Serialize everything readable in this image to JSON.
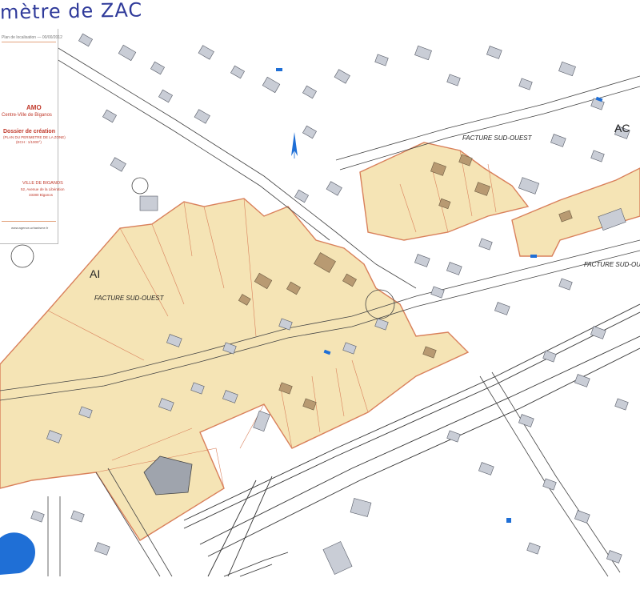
{
  "handwritten_title": "mètre de ZAC",
  "legend": {
    "header_line": "Plan de localisation — 00/00/2012",
    "amo": "AMO",
    "project": "Centre-Ville de Biganos",
    "dossier": "Dossier de création",
    "dossier_sub": "(PLAN DU PERIMETRE DE LA ZONE)",
    "scale": "(ECH : 1/1000°)",
    "client": "VILLE DE BIGANOS",
    "address": "52, Avenue de la Libération",
    "postcode": "33380 Biganos",
    "website": "www.agence-urbanisme.fr"
  },
  "labels": {
    "section_ai": "AI",
    "section_ac": "AC",
    "facture_west": "FACTURE SUD-OUEST",
    "facture_north": "FACTURE SUD-OUEST",
    "facture_east": "FACTURE SUD-OUEST"
  },
  "colors": {
    "zac_fill": "#f5e4b5",
    "zac_stroke": "#d9805b",
    "building": "#c9cdd6",
    "building_stroke": "#555a66",
    "zac_building": "#b89a72",
    "lake": "#1f6fd6",
    "accent_blue": "#2a6fd6",
    "handwriting": "#2f3a9a"
  },
  "icons": [
    "north-arrow-icon"
  ]
}
